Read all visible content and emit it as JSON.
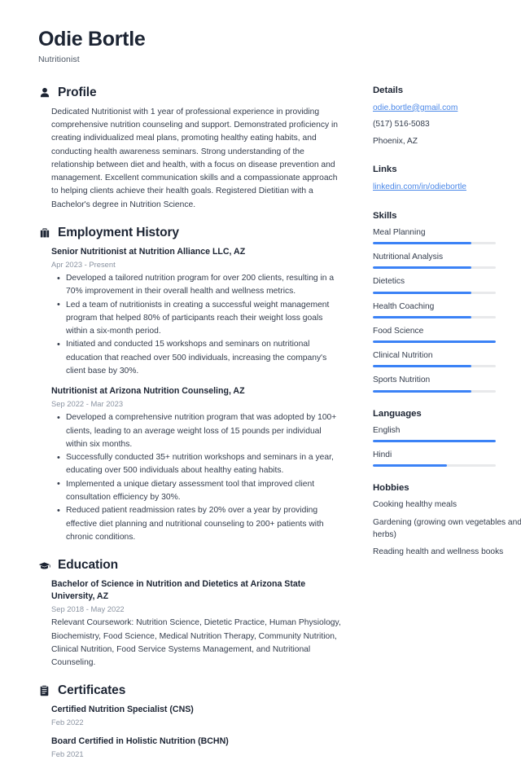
{
  "header": {
    "name": "Odie Bortle",
    "job_title": "Nutritionist"
  },
  "theme": {
    "accent": "#3b82f6",
    "link": "#4a87e8",
    "heading": "#1c2433",
    "body_text": "#333c4c",
    "muted_text": "#8a93a1",
    "track": "#e8e9eb",
    "background": "#ffffff"
  },
  "main": {
    "profile": {
      "icon": "user-icon",
      "title": "Profile",
      "text": "Dedicated Nutritionist with 1 year of professional experience in providing comprehensive nutrition counseling and support. Demonstrated proficiency in creating individualized meal plans, promoting healthy eating habits, and conducting health awareness seminars. Strong understanding of the relationship between diet and health, with a focus on disease prevention and management. Excellent communication skills and a compassionate approach to helping clients achieve their health goals. Registered Dietitian with a Bachelor's degree in Nutrition Science."
    },
    "employment": {
      "icon": "briefcase-icon",
      "title": "Employment History",
      "entries": [
        {
          "title": "Senior Nutritionist at Nutrition Alliance LLC, AZ",
          "date": "Apr 2023 - Present",
          "bullets": [
            "Developed a tailored nutrition program for over 200 clients, resulting in a 70% improvement in their overall health and wellness metrics.",
            "Led a team of nutritionists in creating a successful weight management program that helped 80% of participants reach their weight loss goals within a six-month period.",
            "Initiated and conducted 15 workshops and seminars on nutritional education that reached over 500 individuals, increasing the company's client base by 30%."
          ]
        },
        {
          "title": "Nutritionist at Arizona Nutrition Counseling, AZ",
          "date": "Sep 2022 - Mar 2023",
          "bullets": [
            "Developed a comprehensive nutrition program that was adopted by 100+ clients, leading to an average weight loss of 15 pounds per individual within six months.",
            "Successfully conducted 35+ nutrition workshops and seminars in a year, educating over 500 individuals about healthy eating habits.",
            "Implemented a unique dietary assessment tool that improved client consultation efficiency by 30%.",
            "Reduced patient readmission rates by 20% over a year by providing effective diet planning and nutritional counseling to 200+ patients with chronic conditions."
          ]
        }
      ]
    },
    "education": {
      "icon": "graduation-cap-icon",
      "title": "Education",
      "entries": [
        {
          "title": "Bachelor of Science in Nutrition and Dietetics at Arizona State University, AZ",
          "date": "Sep 2018 - May 2022",
          "description": "Relevant Coursework: Nutrition Science, Dietetic Practice, Human Physiology, Biochemistry, Food Science, Medical Nutrition Therapy, Community Nutrition, Clinical Nutrition, Food Service Systems Management, and Nutritional Counseling."
        }
      ]
    },
    "certificates": {
      "icon": "clipboard-icon",
      "title": "Certificates",
      "entries": [
        {
          "title": "Certified Nutrition Specialist (CNS)",
          "date": "Feb 2022"
        },
        {
          "title": "Board Certified in Holistic Nutrition (BCHN)",
          "date": "Feb 2021"
        }
      ]
    }
  },
  "sidebar": {
    "details": {
      "title": "Details",
      "email": "odie.bortle@gmail.com",
      "phone": "(517) 516-5083",
      "location": "Phoenix, AZ"
    },
    "links": {
      "title": "Links",
      "items": [
        {
          "label": "linkedin.com/in/odiebortle"
        }
      ]
    },
    "skills": {
      "title": "Skills",
      "items": [
        {
          "label": "Meal Planning",
          "level": 80
        },
        {
          "label": "Nutritional Analysis",
          "level": 80
        },
        {
          "label": "Dietetics",
          "level": 80
        },
        {
          "label": "Health Coaching",
          "level": 80
        },
        {
          "label": "Food Science",
          "level": 100
        },
        {
          "label": "Clinical Nutrition",
          "level": 80
        },
        {
          "label": "Sports Nutrition",
          "level": 80
        }
      ]
    },
    "languages": {
      "title": "Languages",
      "items": [
        {
          "label": "English",
          "level": 100
        },
        {
          "label": "Hindi",
          "level": 60
        }
      ]
    },
    "hobbies": {
      "title": "Hobbies",
      "items": [
        "Cooking healthy meals",
        "Gardening (growing own vegetables and herbs)",
        "Reading health and wellness books"
      ]
    }
  }
}
